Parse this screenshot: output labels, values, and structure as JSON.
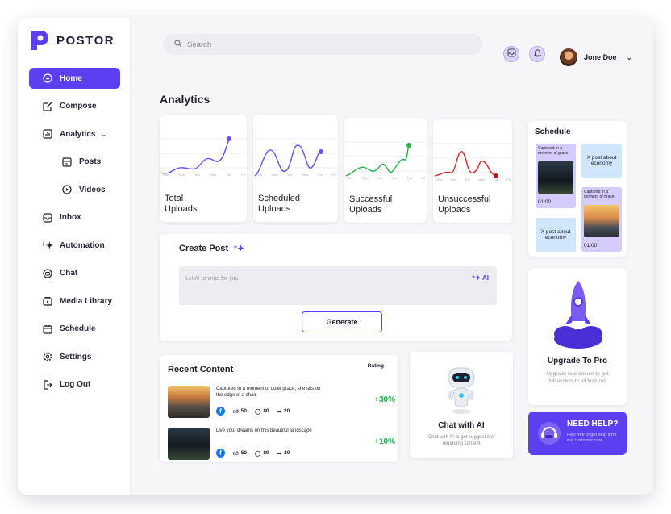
{
  "brand": {
    "name": "POSTOR",
    "accent": "#5b3ff0"
  },
  "sidebar": {
    "items": [
      {
        "label": "Home",
        "icon": "home-icon"
      },
      {
        "label": "Compose",
        "icon": "compose-icon"
      },
      {
        "label": "Analytics",
        "icon": "analytics-icon"
      },
      {
        "label": "Posts",
        "icon": "posts-icon"
      },
      {
        "label": "Videos",
        "icon": "videos-icon"
      },
      {
        "label": "Inbox",
        "icon": "inbox-icon"
      },
      {
        "label": "Automation",
        "icon": "sparkle-icon"
      },
      {
        "label": "Chat",
        "icon": "chat-icon"
      },
      {
        "label": "Media Library",
        "icon": "media-library-icon"
      },
      {
        "label": "Schedule",
        "icon": "calendar-icon"
      },
      {
        "label": "Settings",
        "icon": "gear-icon"
      },
      {
        "label": "Log Out",
        "icon": "logout-icon"
      }
    ]
  },
  "topbar": {
    "search_placeholder": "Search",
    "user_name": "Jone Doe"
  },
  "page_title": "Analytics",
  "stats": [
    {
      "label": "Total\nUploads",
      "color": "#6b4df0"
    },
    {
      "label": "Scheduled\nUploads",
      "color": "#6b4df0"
    },
    {
      "label": "Successful\nUploads",
      "color": "#22b14c"
    },
    {
      "label": "Unsuccessful\nUploads",
      "color": "#d42a2a"
    }
  ],
  "days": [
    "Sun",
    "Mon",
    "Tue",
    "Wed",
    "Thu",
    "Fri"
  ],
  "schedule": {
    "title": "Schedule",
    "cards": [
      {
        "text": "Captured in a moment of grace",
        "time": "01:00"
      },
      {
        "text": "X post about economy"
      },
      {
        "text": "Captured in a moment of grace",
        "time": "01:00"
      },
      {
        "text": "X post about economy"
      }
    ]
  },
  "create_post": {
    "title": "Create Post",
    "placeholder": "Let Ai to write for you",
    "ai_tag": "AI",
    "button": "Generate"
  },
  "recent": {
    "title": "Recent Content",
    "rating_label": "Rating",
    "rows": [
      {
        "text": "Captured in a moment of quiet grace, she sits on the edge of a chair",
        "likes": "50",
        "comments": "80",
        "shares": "20",
        "rating": "+30%"
      },
      {
        "text": "Live your dreams on this beautiful landscape",
        "likes": "50",
        "comments": "80",
        "shares": "20",
        "rating": "+10%"
      }
    ]
  },
  "chat_ai": {
    "title": "Chat with AI",
    "subtitle": "Chat with AI to get suggestions regarding content"
  },
  "upgrade": {
    "title": "Upgrade To Pro",
    "subtitle": "Upgrade to premium to get full access to all features"
  },
  "help": {
    "title": "NEED HELP?",
    "subtitle": "Feel free to get help form our customer care"
  }
}
